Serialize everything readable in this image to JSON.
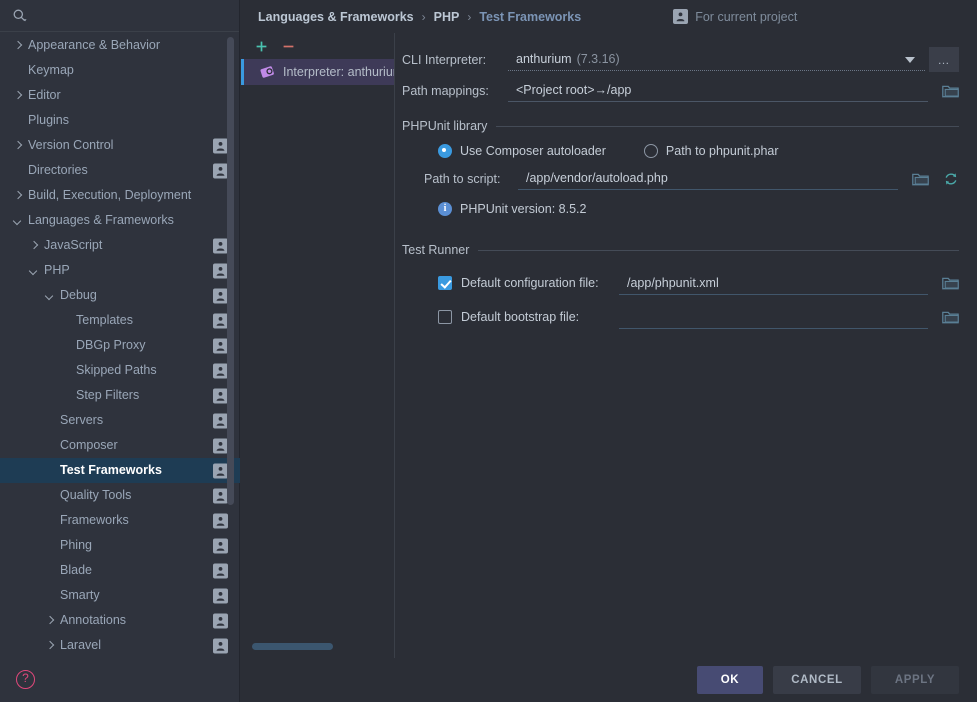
{
  "search": {
    "icon": "search-icon",
    "placeholder": ""
  },
  "sidebar": {
    "items": [
      {
        "label": "Appearance & Behavior",
        "indent": 0,
        "twisty": "right",
        "badge": false
      },
      {
        "label": "Keymap",
        "indent": 0,
        "twisty": "none",
        "badge": false
      },
      {
        "label": "Editor",
        "indent": 0,
        "twisty": "right",
        "badge": false
      },
      {
        "label": "Plugins",
        "indent": 0,
        "twisty": "none",
        "badge": false
      },
      {
        "label": "Version Control",
        "indent": 0,
        "twisty": "right",
        "badge": true
      },
      {
        "label": "Directories",
        "indent": 0,
        "twisty": "none",
        "badge": true
      },
      {
        "label": "Build, Execution, Deployment",
        "indent": 0,
        "twisty": "right",
        "badge": false
      },
      {
        "label": "Languages & Frameworks",
        "indent": 0,
        "twisty": "down",
        "badge": false
      },
      {
        "label": "JavaScript",
        "indent": 1,
        "twisty": "right",
        "badge": true
      },
      {
        "label": "PHP",
        "indent": 1,
        "twisty": "down",
        "badge": true
      },
      {
        "label": "Debug",
        "indent": 2,
        "twisty": "down",
        "badge": true
      },
      {
        "label": "Templates",
        "indent": 3,
        "twisty": "none",
        "badge": true
      },
      {
        "label": "DBGp Proxy",
        "indent": 3,
        "twisty": "none",
        "badge": true
      },
      {
        "label": "Skipped Paths",
        "indent": 3,
        "twisty": "none",
        "badge": true
      },
      {
        "label": "Step Filters",
        "indent": 3,
        "twisty": "none",
        "badge": true
      },
      {
        "label": "Servers",
        "indent": 2,
        "twisty": "none",
        "badge": true
      },
      {
        "label": "Composer",
        "indent": 2,
        "twisty": "none",
        "badge": true
      },
      {
        "label": "Test Frameworks",
        "indent": 2,
        "twisty": "none",
        "badge": true,
        "selected": true
      },
      {
        "label": "Quality Tools",
        "indent": 2,
        "twisty": "none",
        "badge": true
      },
      {
        "label": "Frameworks",
        "indent": 2,
        "twisty": "none",
        "badge": true
      },
      {
        "label": "Phing",
        "indent": 2,
        "twisty": "none",
        "badge": true
      },
      {
        "label": "Blade",
        "indent": 2,
        "twisty": "none",
        "badge": true
      },
      {
        "label": "Smarty",
        "indent": 2,
        "twisty": "none",
        "badge": true
      },
      {
        "label": "Annotations",
        "indent": 2,
        "twisty": "right",
        "badge": true
      },
      {
        "label": "Laravel",
        "indent": 2,
        "twisty": "right",
        "badge": true
      }
    ],
    "help_label": "?"
  },
  "breadcrumb": {
    "items": [
      "Languages & Frameworks",
      "PHP",
      "Test Frameworks"
    ],
    "separator": "›",
    "for_current_project": "For current project"
  },
  "list_panel": {
    "add_label": "+",
    "remove_label": "−",
    "items": [
      {
        "label": "Interpreter: anthurium",
        "selected": true
      }
    ]
  },
  "main": {
    "cli_interpreter": {
      "label": "CLI Interpreter:",
      "value": "anthurium",
      "version": "(7.3.16)",
      "ellipsis_label": "…"
    },
    "path_mappings": {
      "label": "Path mappings:",
      "value": "<Project root>→/app"
    },
    "phpunit_library": {
      "title": "PHPUnit library",
      "option_composer": "Use Composer autoloader",
      "option_phar": "Path to phpunit.phar",
      "selected": "composer",
      "path_to_script_label": "Path to script:",
      "path_to_script_value": "/app/vendor/autoload.php",
      "version_text": "PHPUnit version: 8.5.2",
      "info_glyph": "i"
    },
    "test_runner": {
      "title": "Test Runner",
      "default_config": {
        "label": "Default configuration file:",
        "checked": true,
        "value": "/app/phpunit.xml"
      },
      "default_bootstrap": {
        "label": "Default bootstrap file:",
        "checked": false,
        "value": ""
      }
    }
  },
  "footer": {
    "ok": "OK",
    "cancel": "CANCEL",
    "apply": "APPLY"
  },
  "colors": {
    "accent_blue": "#3a9ae0",
    "selection_blue": "#1e3c54",
    "ok_button": "#474b73",
    "help_pink": "#e0487b",
    "teal": "#4aa8a8",
    "background": "#2b2e36",
    "sidebar_bg": "#2f333d"
  }
}
